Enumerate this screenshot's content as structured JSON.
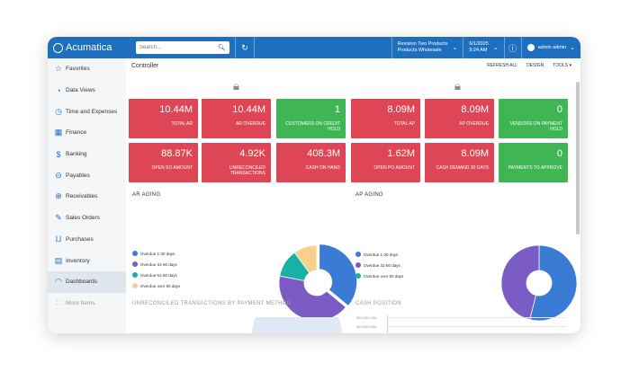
{
  "brand": "Acumatica",
  "search": {
    "placeholder": "Search..."
  },
  "branch": {
    "line1": "Revision Two Products",
    "line2": "Products Wholesale"
  },
  "date": {
    "line1": "6/1/2025",
    "line2": "9:24 AM"
  },
  "user": {
    "name": "admin admin"
  },
  "sidebar": {
    "items": [
      {
        "label": "Favorites",
        "icon": "star-icon"
      },
      {
        "label": "Data Views",
        "icon": "pie-chart-icon"
      },
      {
        "label": "Time and Expenses",
        "icon": "stopwatch-icon"
      },
      {
        "label": "Finance",
        "icon": "calculator-icon"
      },
      {
        "label": "Banking",
        "icon": "dollar-icon"
      },
      {
        "label": "Payables",
        "icon": "minus-circle-icon"
      },
      {
        "label": "Receivables",
        "icon": "plus-circle-icon"
      },
      {
        "label": "Sales Orders",
        "icon": "edit-icon"
      },
      {
        "label": "Purchases",
        "icon": "cart-icon"
      },
      {
        "label": "Inventory",
        "icon": "truck-icon"
      },
      {
        "label": "Dashboards",
        "icon": "gauge-icon"
      },
      {
        "label": "More Items",
        "icon": "grid-icon"
      }
    ]
  },
  "page": {
    "title": "Controller",
    "refresh": "REFRESH ALL",
    "design": "DESIGN",
    "tools": "TOOLS ▾"
  },
  "tiles": [
    {
      "value": "10.44M",
      "label": "TOTAL AR",
      "color": "#df4655"
    },
    {
      "value": "10.44M",
      "label": "AR OVERDUE",
      "color": "#df4655"
    },
    {
      "value": "1",
      "label": "CUSTOMERS ON CREDIT HOLD",
      "color": "#3fb653"
    },
    {
      "value": "8.09M",
      "label": "TOTAL AP",
      "color": "#df4655"
    },
    {
      "value": "8.09M",
      "label": "AP OVERDUE",
      "color": "#df4655"
    },
    {
      "value": "0",
      "label": "VENDORS ON PAYMENT HOLD",
      "color": "#3fb653"
    },
    {
      "value": "88.87K",
      "label": "OPEN SO AMOUNT",
      "color": "#df4655"
    },
    {
      "value": "4.92K",
      "label": "UNRECONCILED TRANSACTIONS",
      "color": "#df4655"
    },
    {
      "value": "408.3M",
      "label": "CASH ON HAND",
      "color": "#df4655"
    },
    {
      "value": "1.62M",
      "label": "OPEN PO AMOUNT",
      "color": "#df4655"
    },
    {
      "value": "8.09M",
      "label": "CASH DEMAND 30 DAYS",
      "color": "#df4655"
    },
    {
      "value": "0",
      "label": "PAYMENTS TO APPROVE",
      "color": "#3fb653"
    }
  ],
  "ar_aging": {
    "title": "AR AGING",
    "legend": [
      {
        "label": "Overdue 1-30 days",
        "color": "#3a7bd5"
      },
      {
        "label": "Overdue 31-60 days",
        "color": "#7b5cc4"
      },
      {
        "label": "Overdue 61-90 days",
        "color": "#17b1a5"
      },
      {
        "label": "Overdue over 90 days",
        "color": "#f7d08a"
      }
    ],
    "shares": [
      0.36,
      0.42,
      0.12,
      0.1
    ]
  },
  "ap_aging": {
    "title": "AP AGING",
    "legend": [
      {
        "label": "Overdue 1-30 days",
        "color": "#3a7bd5"
      },
      {
        "label": "Overdue 31-60 days",
        "color": "#7b5cc4"
      },
      {
        "label": "Overdue over 90 days",
        "color": "#17b1a5"
      }
    ],
    "shares": [
      0.54,
      0.46,
      0.0
    ]
  },
  "unreconciled": {
    "title": "UNRECONCILED TRANSACTIONS BY PAYMENT METHOD"
  },
  "cash_position": {
    "title": "CASH POSITION",
    "tick1": "$50,000,000",
    "tick2": "$40,000,000"
  }
}
